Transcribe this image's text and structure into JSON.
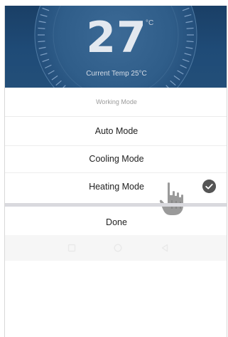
{
  "thermostat": {
    "temperature": "27",
    "unit": "°C",
    "current_temp_label": "Current Temp 25°C"
  },
  "mode_sheet": {
    "title": "Working Mode",
    "options": [
      {
        "label": "Auto Mode",
        "selected": false
      },
      {
        "label": "Cooling Mode",
        "selected": false
      },
      {
        "label": "Heating Mode",
        "selected": true
      }
    ],
    "done_label": "Done"
  },
  "icons": {
    "selected_check": "checkmark-circle-icon",
    "pointer": "hand-pointer-icon",
    "nav_recents": "square-icon",
    "nav_home": "circle-icon",
    "nav_back": "triangle-back-icon"
  },
  "colors": {
    "header_background": "#1f4b77",
    "check_fill": "#555555",
    "separator": "#d9d9de"
  }
}
